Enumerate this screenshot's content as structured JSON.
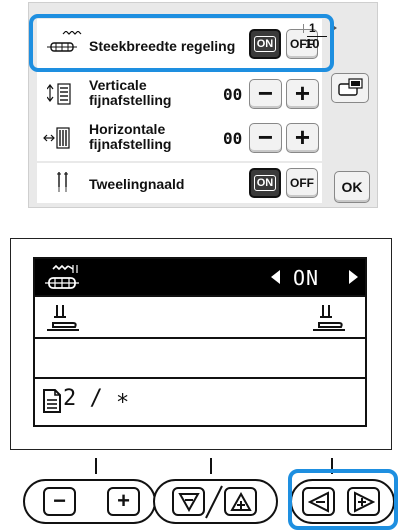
{
  "touch_screen": {
    "page_indicator": {
      "current": "1",
      "total": "10"
    },
    "rows": [
      {
        "label": "Steekbreedte regeling",
        "on": "ON",
        "off": "OFF",
        "selected": "ON"
      },
      {
        "label_line1": "Verticale",
        "label_line2": "fijnafstelling",
        "value": "00",
        "minus": "−",
        "plus": "+"
      },
      {
        "label_line1": "Horizontale",
        "label_line2": "fijnafstelling",
        "value": "00",
        "minus": "−",
        "plus": "+"
      },
      {
        "label": "Tweelingnaald",
        "on": "ON",
        "off": "OFF",
        "selected": "ON"
      }
    ],
    "ok_label": "OK"
  },
  "lcd": {
    "row1_value": "ON",
    "row4_text": "2 / ∗"
  },
  "keys": {
    "minus": "−",
    "plus": "+"
  },
  "colors": {
    "highlight": "#1e8fe0",
    "panel_bg": "#e9e9e9",
    "on_button": "#3a3a3a"
  }
}
